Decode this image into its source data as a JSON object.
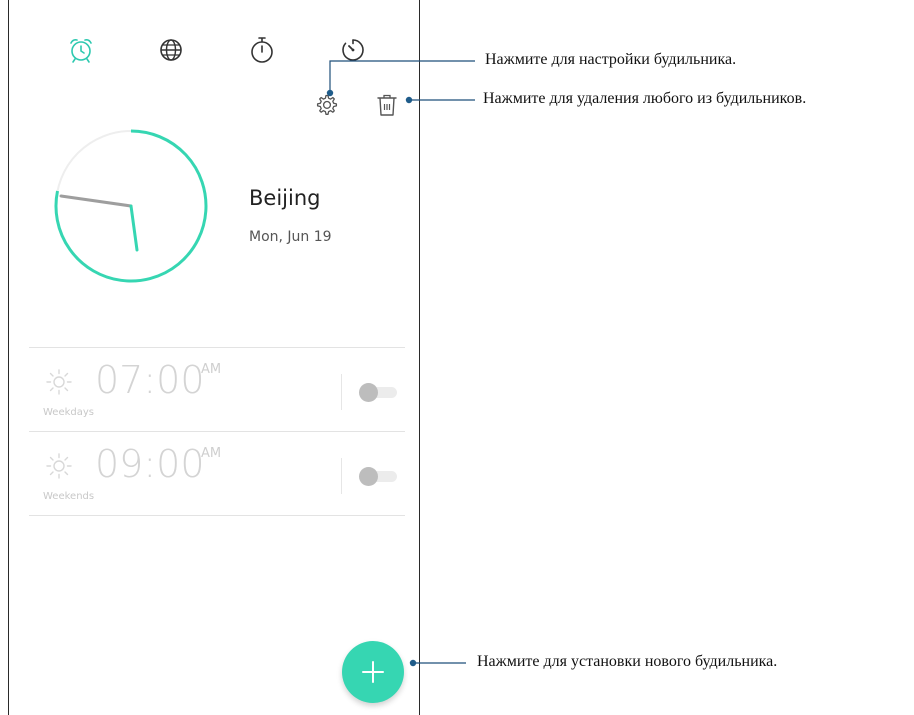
{
  "tabs": [
    {
      "name": "alarm",
      "icon": "alarm-clock-icon",
      "active": true
    },
    {
      "name": "world-clock",
      "icon": "globe-icon",
      "active": false
    },
    {
      "name": "stopwatch",
      "icon": "stopwatch-icon",
      "active": false
    },
    {
      "name": "timer",
      "icon": "timer-icon",
      "active": false
    }
  ],
  "toolbar": {
    "settings_icon": "gear-icon",
    "delete_icon": "trash-icon"
  },
  "world_clock": {
    "city": "Beijing",
    "date": "Mon, Jun 19"
  },
  "alarms": [
    {
      "time": "07:00",
      "ampm": "AM",
      "repeat": "Weekdays",
      "enabled": false,
      "icon": "sun-icon"
    },
    {
      "time": "09:00",
      "ampm": "AM",
      "repeat": "Weekends",
      "enabled": false,
      "icon": "sun-icon"
    }
  ],
  "fab": {
    "icon": "plus-icon"
  },
  "callouts": {
    "settings": "Нажмите для настройки будильника.",
    "delete": "Нажмите для удаления любого из будильников.",
    "add": "Нажмите для установки нового будильника."
  },
  "colors": {
    "accent": "#36d6b2",
    "active_tab": "#2ec9b0",
    "icon_dark": "#333333",
    "callout_line": "#1f4f7a",
    "dot": "#1f5c8a"
  }
}
